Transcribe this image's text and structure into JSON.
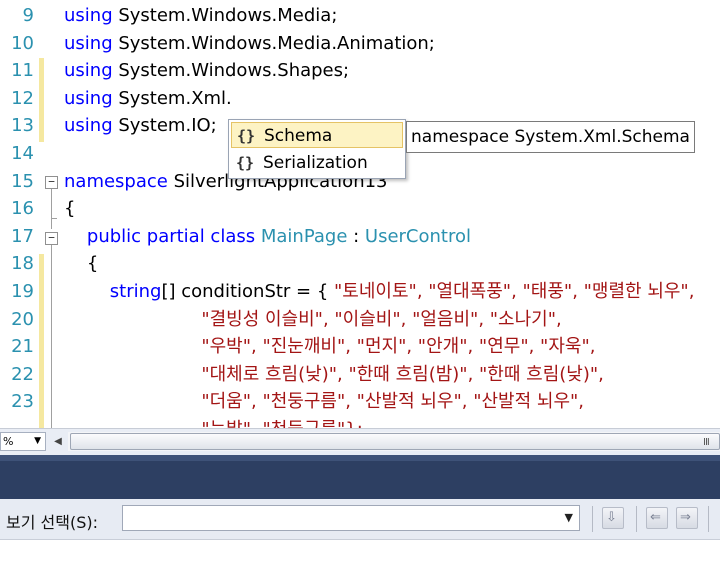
{
  "editor": {
    "lines": [
      {
        "num": "9",
        "tokens": [
          {
            "t": "using",
            "c": "kw"
          },
          {
            "t": " System.Windows.Media;",
            "c": ""
          }
        ]
      },
      {
        "num": "10",
        "tokens": [
          {
            "t": "using",
            "c": "kw"
          },
          {
            "t": " System.Windows.Media.Animation;",
            "c": ""
          }
        ]
      },
      {
        "num": "11",
        "tokens": [
          {
            "t": "using",
            "c": "kw"
          },
          {
            "t": " System.Windows.Shapes;",
            "c": ""
          }
        ]
      },
      {
        "num": "12",
        "tokens": [
          {
            "t": "using",
            "c": "kw"
          },
          {
            "t": " System.Xml.",
            "c": ""
          }
        ]
      },
      {
        "num": "13",
        "tokens": [
          {
            "t": "using",
            "c": "kw"
          },
          {
            "t": " System.IO;",
            "c": ""
          }
        ]
      },
      {
        "num": "14",
        "tokens": []
      },
      {
        "num": "15",
        "tokens": [
          {
            "t": "namespace",
            "c": "kw"
          },
          {
            "t": " SilverlightApplication13",
            "c": ""
          }
        ]
      },
      {
        "num": "16",
        "tokens": [
          {
            "t": "{",
            "c": ""
          }
        ]
      },
      {
        "num": "17",
        "tokens": [
          {
            "t": "    public partial class ",
            "c": "kw"
          },
          {
            "t": "MainPage",
            "c": "ty"
          },
          {
            "t": " : ",
            "c": ""
          },
          {
            "t": "UserControl",
            "c": "ty"
          }
        ]
      },
      {
        "num": "18",
        "tokens": [
          {
            "t": "    {",
            "c": ""
          }
        ]
      },
      {
        "num": "19",
        "tokens": [
          {
            "t": "        string",
            "c": "kw"
          },
          {
            "t": "[] conditionStr = { ",
            "c": ""
          },
          {
            "t": "\"토네이토\", \"열대폭풍\", \"태풍\", \"맹렬한 뇌우\",",
            "c": "st"
          }
        ]
      },
      {
        "num": "20",
        "tokens": [
          {
            "t": "                        \"결빙성 이슬비\", \"이슬비\", \"얼음비\", \"소나기\",",
            "c": "st"
          }
        ]
      },
      {
        "num": "21",
        "tokens": [
          {
            "t": "                        \"우박\", \"진눈깨비\", \"먼지\", \"안개\", \"연무\", \"자욱\",",
            "c": "st"
          }
        ]
      },
      {
        "num": "22",
        "tokens": [
          {
            "t": "                        \"대체로 흐림(낮)\", \"한때 흐림(밤)\", \"한때 흐림(낮)\",",
            "c": "st"
          }
        ]
      },
      {
        "num": "23",
        "tokens": [
          {
            "t": "                        \"더움\", \"천둥구름\", \"산발적 뇌우\", \"산발적 뇌우\",",
            "c": "st"
          }
        ]
      },
      {
        "num": "",
        "tokens": [
          {
            "t": "                        \"눈발\", \"천둥구름\"};",
            "c": "st"
          }
        ]
      }
    ]
  },
  "intellisense": {
    "items": [
      {
        "icon": "{}",
        "label": "Schema",
        "selected": true
      },
      {
        "icon": "{}",
        "label": "Serialization",
        "selected": false
      }
    ],
    "tooltip": "namespace System.Xml.Schema"
  },
  "hscroll": {
    "dropdown_value": "%",
    "grip": "III"
  },
  "output_toolbar": {
    "label": "보기 선택(S):",
    "combo_value": ""
  }
}
